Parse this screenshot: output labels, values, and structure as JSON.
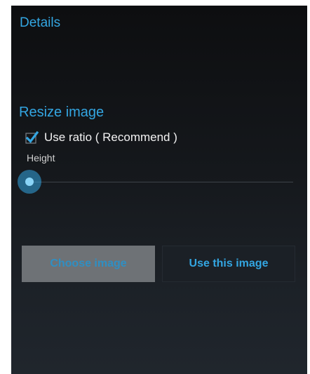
{
  "details": {
    "title": "Details"
  },
  "resize": {
    "title": "Resize image",
    "use_ratio": {
      "label": "Use ratio ( Recommend )",
      "checked": true
    },
    "height": {
      "label": "Height",
      "value_fraction": 0.0
    }
  },
  "buttons": {
    "choose_label": "Choose image",
    "use_label": "Use this image"
  },
  "colors": {
    "accent": "#33a6e2",
    "background": "#15181c",
    "choose_button_bg": "#6e7276"
  },
  "icons": {
    "checkbox": "checkmark-icon"
  }
}
